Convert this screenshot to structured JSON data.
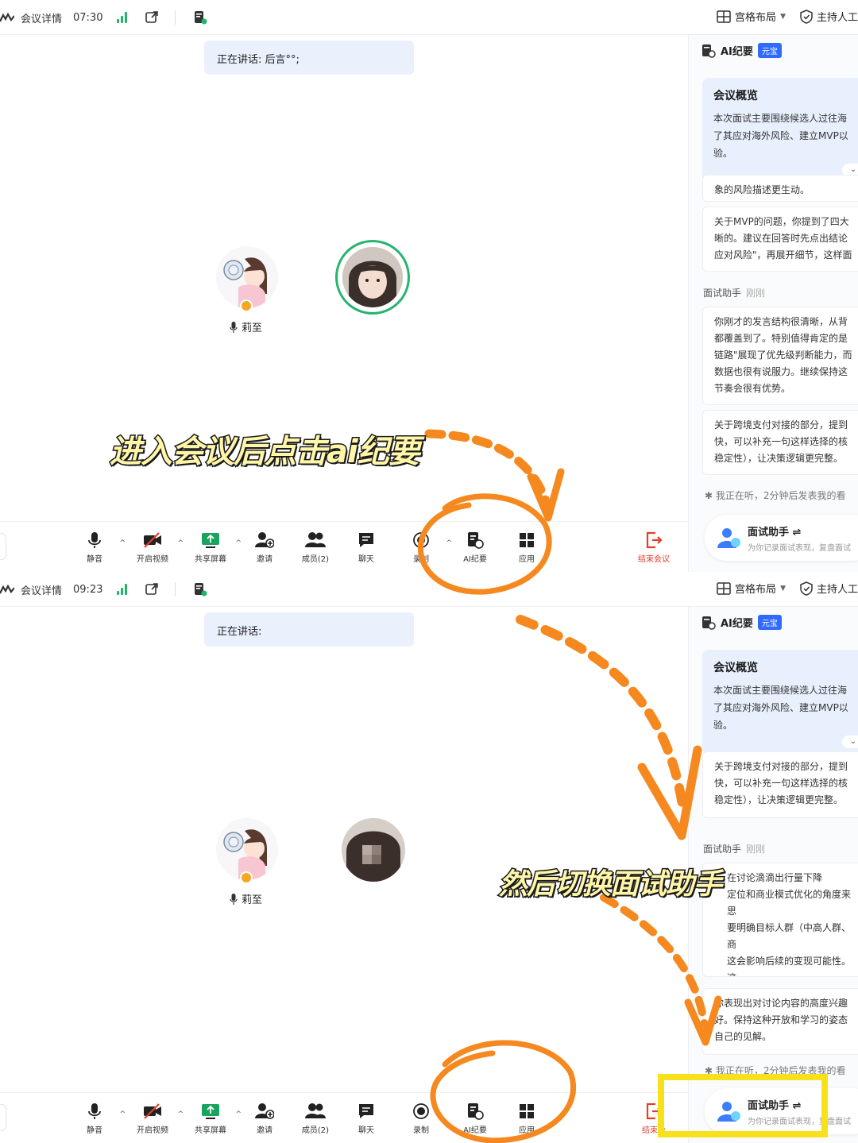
{
  "screens": [
    {
      "topbar": {
        "meeting_details": "会议详情",
        "time": "07:30",
        "layout_label": "宫格布局",
        "host_label": "主持人工"
      },
      "speaking_text": "正在讲话: 后言°°;",
      "participant_name": "莉至",
      "toolbar": {
        "mute": "静音",
        "video": "开启视频",
        "share": "共享屏幕",
        "invite": "邀请",
        "members": "成员(2)",
        "chat": "聊天",
        "record": "录制",
        "ai_summary": "AI纪要",
        "apps": "应用",
        "end": "结束会议"
      },
      "panel": {
        "title": "AI纪要",
        "tag": "元宝",
        "overview_title": "会议概览",
        "overview_body": "本次面试主要围绕候选人过往海\n了其应对海外风险、建立MVP以\n验。",
        "card1": "象的风险描述更生动。",
        "card2": "关于MVP的问题，你提到了四大\n晰的。建议在回答时先点出结论\n应对风险\"，再展开细节，这样面",
        "section_label": "面试助手",
        "section_time": "刚刚",
        "card3": "你刚才的发言结构很清晰，从背\n都覆盖到了。特别值得肯定的是\n链路\"展现了优先级判断能力，而\n数据也很有说服力。继续保持这\n节奏会很有优势。",
        "card4": "关于跨境支付对接的部分，提到\n快，可以补充一句这样选择的核\n稳定性），让决策逻辑更完整。",
        "listening": "我正在听，2分钟后发表我的看",
        "assistant_title": "面试助手",
        "assistant_sub": "为你记录面试表现，复盘面试"
      }
    },
    {
      "topbar": {
        "meeting_details": "会议详情",
        "time": "09:23",
        "layout_label": "宫格布局",
        "host_label": "主持人工"
      },
      "speaking_text": "正在讲话:",
      "participant_name": "莉至",
      "toolbar": {
        "mute": "静音",
        "video": "开启视频",
        "share": "共享屏幕",
        "invite": "邀请",
        "members": "成员(2)",
        "chat": "聊天",
        "record": "录制",
        "ai_summary": "AI纪要",
        "apps": "应用",
        "end": "结束会"
      },
      "panel": {
        "title": "AI纪要",
        "tag": "元宝",
        "overview_title": "会议概览",
        "overview_body": "本次面试主要围绕候选人过往海\n了其应对海外风险、建立MVP以\n验。",
        "card1": "关于跨境支付对接的部分，提到\n快，可以补充一句这样选择的核\n稳定性），让决策逻辑更完整。",
        "section_label": "面试助手",
        "section_time": "刚刚",
        "card2": "在讨论滴滴出行量下降\n定位和商业模式优化的角度来思\n要明确目标人群（中高人群、商\n这会影响后续的变现可能性。这\n定位与目标人群的需求更紧密地\n准备。",
        "card3": "你表现出对讨论内容的高度兴趣\n好。保持这种开放和学习的姿态\n自己的见解。",
        "listening": "我正在听，2分钟后发表我的看",
        "assistant_title": "面试助手",
        "assistant_sub": "为你记录面试表现，复盘面试"
      }
    }
  ],
  "annotations": {
    "caption1": "进入会议后点击ai纪要",
    "caption2": "然后切换面试助手",
    "circle_color": "#f5891f",
    "highlight_color": "#f7e11a"
  }
}
